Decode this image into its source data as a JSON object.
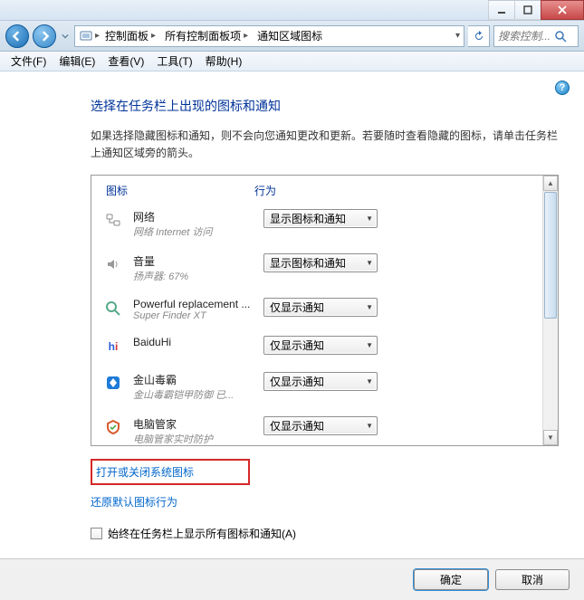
{
  "breadcrumb": {
    "seg1": "控制面板",
    "seg2": "所有控制面板项",
    "seg3": "通知区域图标"
  },
  "search": {
    "placeholder": "搜索控制..."
  },
  "menu": {
    "file": "文件(F)",
    "edit": "编辑(E)",
    "view": "查看(V)",
    "tools": "工具(T)",
    "help": "帮助(H)"
  },
  "page": {
    "title": "选择在任务栏上出现的图标和通知",
    "desc": "如果选择隐藏图标和通知，则不会向您通知更改和更新。若要随时查看隐藏的图标，请单击任务栏上通知区域旁的箭头。",
    "col_icon": "图标",
    "col_action": "行为"
  },
  "items": [
    {
      "title": "网络",
      "sub": "网络 Internet 访问",
      "action": "显示图标和通知"
    },
    {
      "title": "音量",
      "sub": "扬声器: 67%",
      "action": "显示图标和通知"
    },
    {
      "title": "Powerful replacement ...",
      "sub": "Super Finder XT",
      "action": "仅显示通知"
    },
    {
      "title": "BaiduHi",
      "sub": "",
      "action": "仅显示通知"
    },
    {
      "title": "金山毒霸",
      "sub": "金山毒霸铠甲防御 已...",
      "action": "仅显示通知"
    },
    {
      "title": "电脑管家",
      "sub": "电脑管家实时防护",
      "action": "仅显示通知"
    }
  ],
  "links": {
    "system_icons": "打开或关闭系统图标",
    "restore": "还原默认图标行为"
  },
  "checkbox": {
    "label": "始终在任务栏上显示所有图标和通知(A)"
  },
  "buttons": {
    "ok": "确定",
    "cancel": "取消"
  }
}
